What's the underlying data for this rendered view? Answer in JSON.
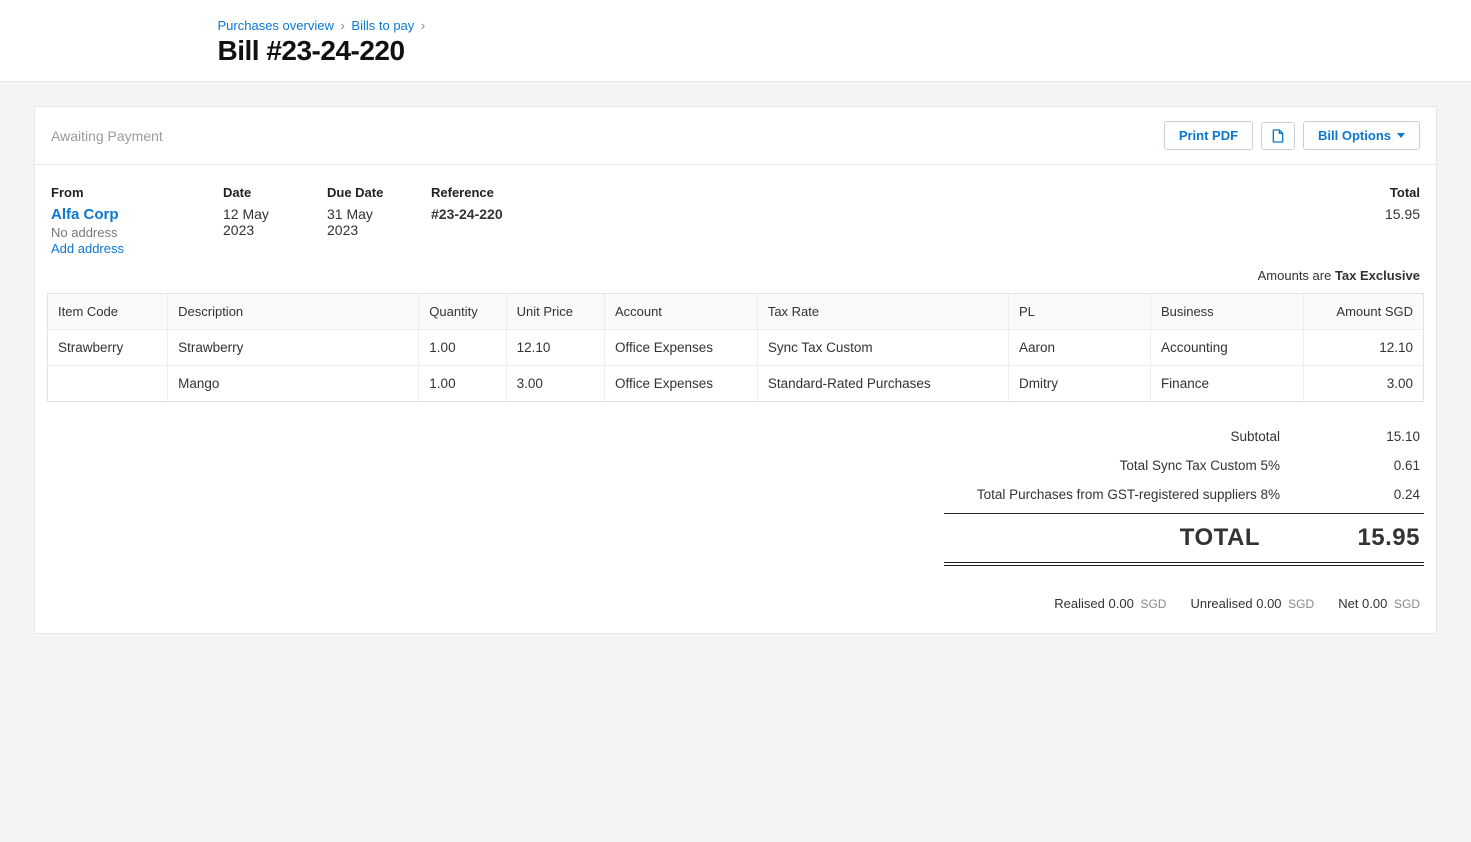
{
  "breadcrumb": {
    "items": [
      "Purchases overview",
      "Bills to pay"
    ]
  },
  "page_title": "Bill #23-24-220",
  "status": "Awaiting Payment",
  "actions": {
    "print_pdf": "Print PDF",
    "bill_options": "Bill Options"
  },
  "meta": {
    "from_label": "From",
    "supplier": "Alfa Corp",
    "no_address": "No address",
    "add_address": "Add address",
    "date_label": "Date",
    "date_value": "12 May 2023",
    "due_label": "Due Date",
    "due_value": "31 May 2023",
    "ref_label": "Reference",
    "ref_value": "#23-24-220",
    "total_label": "Total",
    "total_value": "15.95"
  },
  "tax_mode_prefix": "Amounts are ",
  "tax_mode_value": "Tax Exclusive",
  "columns": {
    "item_code": "Item Code",
    "description": "Description",
    "quantity": "Quantity",
    "unit_price": "Unit Price",
    "account": "Account",
    "tax_rate": "Tax Rate",
    "pl": "PL",
    "business": "Business",
    "amount": "Amount SGD"
  },
  "lines": [
    {
      "item_code": "Strawberry",
      "description": "Strawberry",
      "quantity": "1.00",
      "unit_price": "12.10",
      "account": "Office Expenses",
      "tax_rate": "Sync Tax Custom",
      "pl": "Aaron",
      "business": "Accounting",
      "amount": "12.10"
    },
    {
      "item_code": "",
      "description": "Mango",
      "quantity": "1.00",
      "unit_price": "3.00",
      "account": "Office Expenses",
      "tax_rate": "Standard-Rated Purchases",
      "pl": "Dmitry",
      "business": "Finance",
      "amount": "3.00"
    }
  ],
  "totals": {
    "subtotal_label": "Subtotal",
    "subtotal_value": "15.10",
    "tax1_label": "Total Sync Tax Custom 5%",
    "tax1_value": "0.61",
    "tax2_label": "Total Purchases from GST-registered suppliers 8%",
    "tax2_value": "0.24",
    "grand_label": "TOTAL",
    "grand_value": "15.95"
  },
  "gains": {
    "realised_label": "Realised",
    "realised_value": "0.00",
    "unrealised_label": "Unrealised",
    "unrealised_value": "0.00",
    "net_label": "Net",
    "net_value": "0.00",
    "currency": "SGD"
  }
}
